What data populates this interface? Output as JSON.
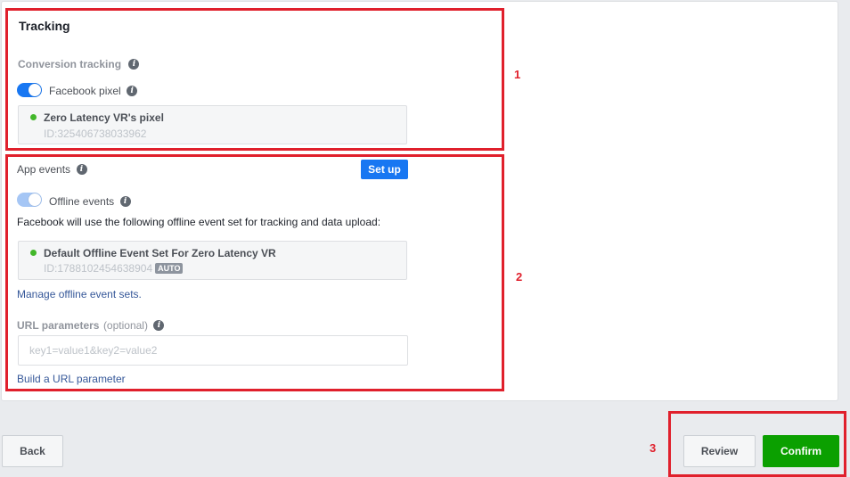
{
  "tracking": {
    "title": "Tracking",
    "conversion_label": "Conversion tracking",
    "pixel_toggle_label": "Facebook pixel",
    "pixel": {
      "name": "Zero Latency VR's pixel",
      "id": "ID:325406738033962"
    }
  },
  "app_events": {
    "label": "App events",
    "setup_label": "Set up",
    "offline_toggle_label": "Offline events",
    "description": "Facebook will use the following offline event set for tracking and data upload:",
    "event_set": {
      "name": "Default Offline Event Set For Zero Latency VR",
      "id": "ID:1788102454638904",
      "badge": "AUTO"
    },
    "manage_link": "Manage offline event sets.",
    "url_params_label": "URL parameters",
    "url_params_optional": "(optional)",
    "url_placeholder": "key1=value1&key2=value2",
    "build_link": "Build a URL parameter"
  },
  "annotations": {
    "one": "1",
    "two": "2",
    "three": "3"
  },
  "footer": {
    "back_label": "Back",
    "review_label": "Review",
    "confirm_label": "Confirm"
  },
  "icons": {
    "info": "info-icon",
    "status": "green-dot"
  },
  "colors": {
    "primary": "#1877f2",
    "confirm": "#0ba000",
    "annotation": "#e0202c"
  }
}
